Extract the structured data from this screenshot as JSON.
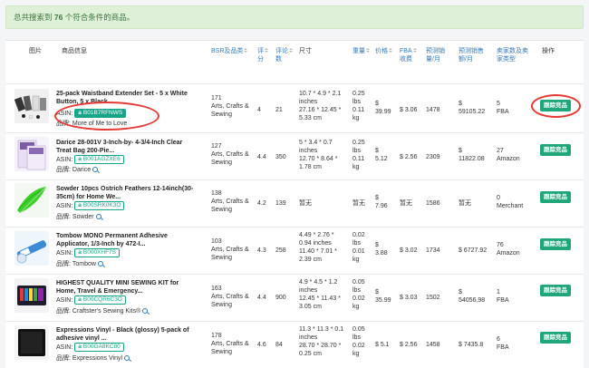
{
  "banner": {
    "prefix": "总共搜索到",
    "count": "76",
    "suffix": "个符合条件的商品。"
  },
  "columns": {
    "image": "图片",
    "info": "商品信息",
    "bsr": [
      "BSR及品类"
    ],
    "rating": [
      "评",
      "分"
    ],
    "reviews": [
      "评论",
      "数"
    ],
    "size": "尺寸",
    "weight": "重量",
    "price": "价格",
    "fba": [
      "FBA",
      "收费"
    ],
    "est_sales": [
      "预测销",
      "量/月"
    ],
    "est_revenue": [
      "预测销售",
      "额/月"
    ],
    "seller": [
      "卖家数及卖",
      "家类型"
    ],
    "action": "操作"
  },
  "labels": {
    "asin": "ASIN:",
    "brand": "品牌:",
    "track": "跟踪竞品",
    "amazon_glyph": "a"
  },
  "icons": {
    "search": "magnifier-icon"
  },
  "rows": [
    {
      "title": [
        "25-pack Waistband Extender Set - 5 x White",
        "Button, 5 x Black..."
      ],
      "asin": "B01B7RFNWS",
      "brand": "More of Me to Love",
      "bsr": [
        "171",
        "Arts, Crafts &",
        "Sewing"
      ],
      "rating": "4",
      "reviews": "21",
      "size": [
        "10.7 * 4.9 * 2.1",
        "inches",
        "27.16 * 12.45 *",
        "5.33 cm"
      ],
      "weight": [
        "0.25",
        "lbs",
        "0.11",
        "kg"
      ],
      "price": [
        "$",
        "39.99"
      ],
      "fba": "$ 3.06",
      "sales": "1478",
      "revenue": [
        "$",
        "59105.22"
      ],
      "seller": [
        "5",
        "FBA"
      ]
    },
    {
      "title": [
        "Darice 28-001V 3-Inch-by- 4-3/4-Inch Clear",
        "Treat Bag 200-Pie..."
      ],
      "asin": "B001AGZXE6",
      "brand": "Darice",
      "bsr": [
        "127",
        "Arts, Crafts &",
        "Sewing"
      ],
      "rating": "4.4",
      "reviews": "350",
      "size": [
        "5 * 3.4 * 0.7",
        "inches",
        "12.70 * 8.64 *",
        "1.78 cm"
      ],
      "weight": [
        "0.25",
        "lbs",
        "0.11",
        "kg"
      ],
      "price": [
        "$",
        "5.12"
      ],
      "fba": "$ 2.56",
      "sales": "2309",
      "revenue": [
        "$",
        "11822.08"
      ],
      "seller": [
        "27",
        "Amazon"
      ]
    },
    {
      "title": [
        "Sowder 10pcs Ostrich Feathers 12-14inch(30-",
        "35cm) for Home We..."
      ],
      "asin": "B00SRK0K3O",
      "brand": "Sowder",
      "bsr": [
        "138",
        "Arts, Crafts &",
        "Sewing"
      ],
      "rating": "4.2",
      "reviews": "139",
      "size": [
        "暂无"
      ],
      "weight": [
        "暂无"
      ],
      "price": [
        "$",
        "7.96"
      ],
      "fba": "暂无",
      "sales": "1586",
      "revenue": [
        "暂无"
      ],
      "seller": [
        "0",
        "Merchant"
      ]
    },
    {
      "title": [
        "Tombow MONO Permanent Adhesive",
        "Applicator, 1/3-Inch by 472-I..."
      ],
      "asin": "B000XHF7S",
      "brand": "Tombow",
      "bsr": [
        "103",
        "Arts, Crafts &",
        "Sewing"
      ],
      "rating": "4.3",
      "reviews": "258",
      "size": [
        "4.49 * 2.76 *",
        "0.94 inches",
        "11.40 * 7.01 *",
        "2.39 cm"
      ],
      "weight": [
        "0.02",
        "lbs",
        "0.01",
        "kg"
      ],
      "price": [
        "$",
        "3.88"
      ],
      "fba": "$ 3.02",
      "sales": "1734",
      "revenue": [
        "$ 6727.92"
      ],
      "seller": [
        "76",
        "Amazon"
      ]
    },
    {
      "title": [
        "HIGHEST QUALITY MINI SEWING KIT for",
        "Home, Travel & Emergency..."
      ],
      "asin": "B00CQR6C3O",
      "brand": "Craftster's Sewing Kits®",
      "bsr": [
        "163",
        "Arts, Crafts &",
        "Sewing"
      ],
      "rating": "4.4",
      "reviews": "900",
      "size": [
        "4.9 * 4.5 * 1.2",
        "inches",
        "12.45 * 11.43 *",
        "3.05 cm"
      ],
      "weight": [
        "0.05",
        "lbs",
        "0.02",
        "kg"
      ],
      "price": [
        "$",
        "35.99"
      ],
      "fba": "$ 3.03",
      "sales": "1502",
      "revenue": [
        "$",
        "54056.98"
      ],
      "seller": [
        "1",
        "FBA"
      ]
    },
    {
      "title": [
        "Expressions Vinyl - Black (glossy) 5-pack of",
        "adhesive vinyl ..."
      ],
      "asin": "B00GA8KC80",
      "brand": "Expressions Vinyl",
      "bsr": [
        "178",
        "Arts, Crafts &",
        "Sewing"
      ],
      "rating": "4.6",
      "reviews": "84",
      "size": [
        "11.3 * 11.3 * 0.1",
        "inches",
        "28.70 * 28.70 *",
        "0.25 cm"
      ],
      "weight": [
        "0.05",
        "lbs",
        "0.02",
        "kg"
      ],
      "price": [
        "$ 5.1"
      ],
      "fba": "$ 2.56",
      "sales": "1458",
      "revenue": [
        "$ 7435.8"
      ],
      "seller": [
        "6",
        "FBA"
      ]
    }
  ]
}
